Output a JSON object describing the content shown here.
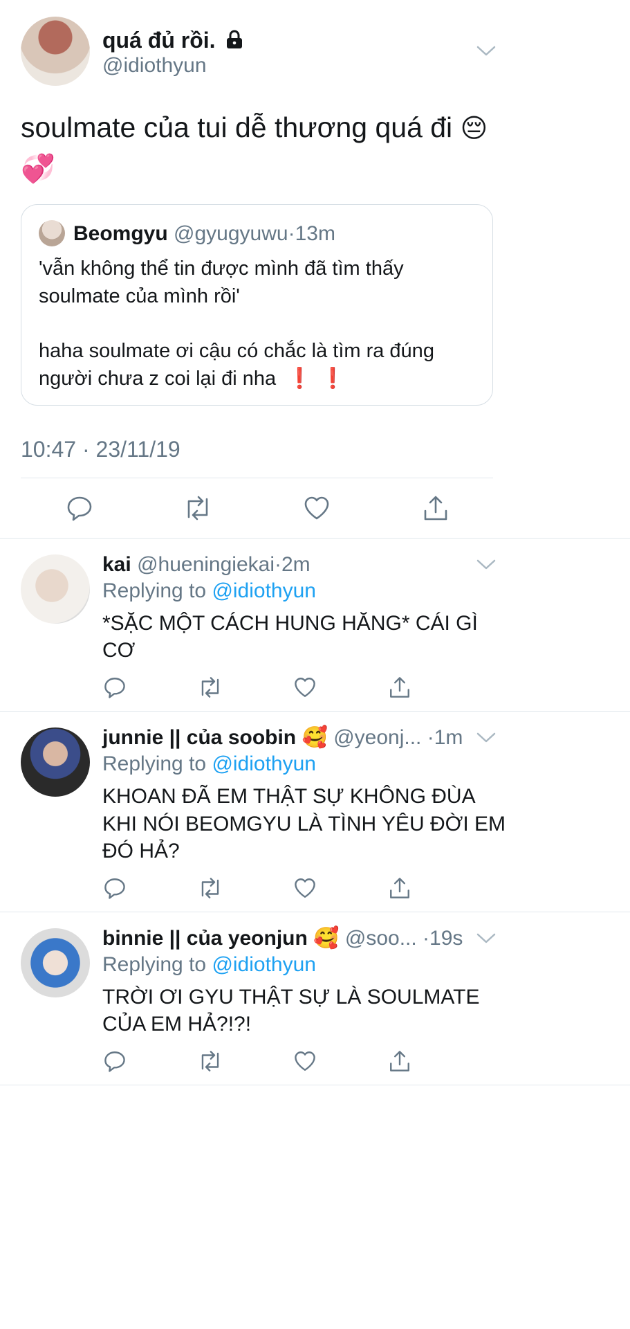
{
  "main_tweet": {
    "display_name": "quá đủ rồi.",
    "handle": "@idiothyun",
    "text": "soulmate của tui dễ thương quá đi",
    "emoji_1": "😔",
    "emoji_2": "💞",
    "quote": {
      "name": "Beomgyu",
      "handle": "@gyugyuwu",
      "dot": "·",
      "time": "13m",
      "line1": "'vẫn không thể tin được mình đã tìm thấy",
      "line2": "soulmate của mình rồi'",
      "line3": "haha soulmate ơi cậu có chắc là tìm ra đúng",
      "line4": "người chưa z coi lại đi nha",
      "emoji": "❗❗"
    },
    "timestamp": "10:47 · 23/11/19"
  },
  "replies": [
    {
      "name": "kai",
      "handle": "@hueningiekai",
      "dot": "·",
      "time": "2m",
      "replying_prefix": "Replying to",
      "replying_handle": "@idiothyun",
      "line1": "*SẶC MỘT CÁCH HUNG HĂNG* CÁI GÌ",
      "line2": "CƠ"
    },
    {
      "name": "junnie || của soobin",
      "emoji": "🥰",
      "handle": "@yeonj...",
      "dot": "·",
      "time": "1m",
      "replying_prefix": "Replying to",
      "replying_handle": "@idiothyun",
      "line1": "KHOAN ĐÃ EM THẬT SỰ KHÔNG ĐÙA",
      "line2": "KHI NÓI BEOMGYU LÀ TÌNH YÊU ĐỜI EM",
      "line3": "ĐÓ HẢ?"
    },
    {
      "name": "binnie || của yeonjun",
      "emoji": "🥰",
      "handle": "@soo...",
      "dot": "·",
      "time": "19s",
      "replying_prefix": "Replying to",
      "replying_handle": "@idiothyun",
      "line1": "TRỜI ƠI GYU THẬT SỰ LÀ SOULMATE",
      "line2": "CỦA EM HẢ?!?!"
    }
  ],
  "icons": {
    "lock": "lock-icon",
    "chevron": "chevron-down-icon",
    "reply": "reply-icon",
    "retweet": "retweet-icon",
    "like": "heart-icon",
    "share": "share-icon"
  },
  "colors": {
    "link": "#1da1f2",
    "muted": "#657786",
    "text": "#14171a"
  }
}
